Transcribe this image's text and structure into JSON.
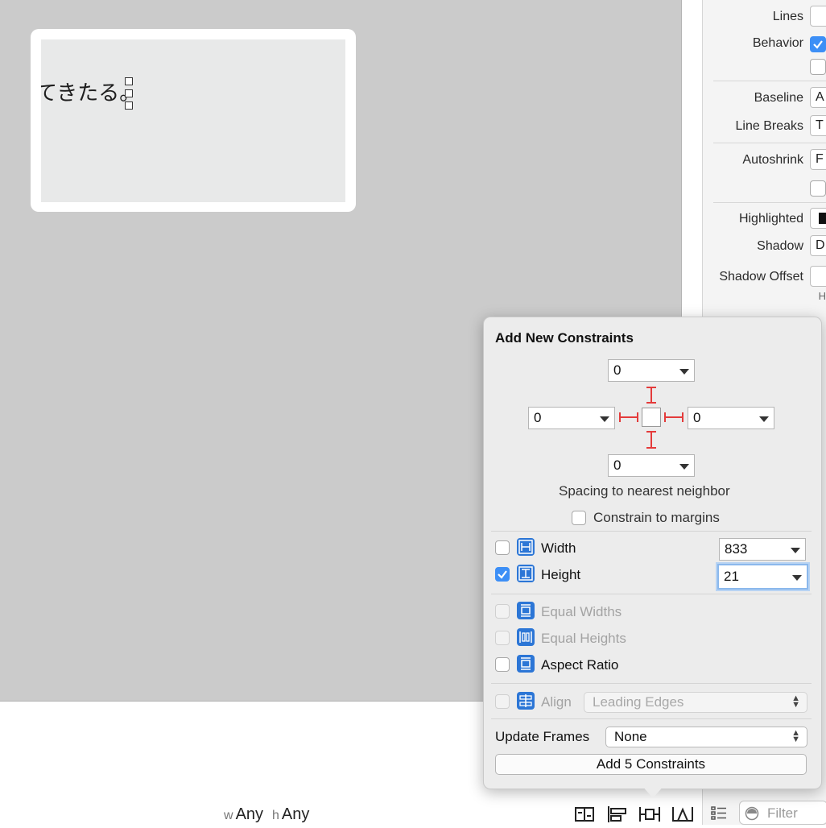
{
  "canvas": {
    "scene_label": "てきたる。",
    "bg_color": "#cbcbcb"
  },
  "size_class": {
    "w_prefix": "w",
    "w_value": "Any",
    "h_prefix": "h",
    "h_value": "Any"
  },
  "toolbar_icons": [
    "embed-in-stack-icon",
    "align-icon",
    "add-constraints-icon",
    "resolve-issues-icon"
  ],
  "inspector": {
    "lines_label": "Lines",
    "behavior_label": "Behavior",
    "behavior_checked": true,
    "baseline_label": "Baseline",
    "baseline_value": "A",
    "line_breaks_label": "Line Breaks",
    "line_breaks_value": "T",
    "autoshrink_label": "Autoshrink",
    "autoshrink_value": "F",
    "highlighted_label": "Highlighted",
    "shadow_label": "Shadow",
    "shadow_value": "D",
    "shadow_offset_label": "Shadow Offset",
    "shadow_offset_sub": "H",
    "filter_placeholder": "Filter"
  },
  "popover": {
    "title": "Add New Constraints",
    "top_value": "0",
    "left_value": "0",
    "right_value": "0",
    "bottom_value": "0",
    "spacing_caption": "Spacing to nearest neighbor",
    "constrain_margins_label": "Constrain to margins",
    "constrain_margins_checked": false,
    "width": {
      "label": "Width",
      "checked": false,
      "value": "833"
    },
    "height": {
      "label": "Height",
      "checked": true,
      "value": "21"
    },
    "equal_widths_label": "Equal Widths",
    "equal_heights_label": "Equal Heights",
    "aspect_ratio_label": "Aspect Ratio",
    "align_label": "Align",
    "align_value": "Leading Edges",
    "update_frames_label": "Update Frames",
    "update_frames_value": "None",
    "add_button_label": "Add 5 Constraints",
    "accent_color": "#3d8ff6",
    "pin_color": "#e43b3b"
  }
}
